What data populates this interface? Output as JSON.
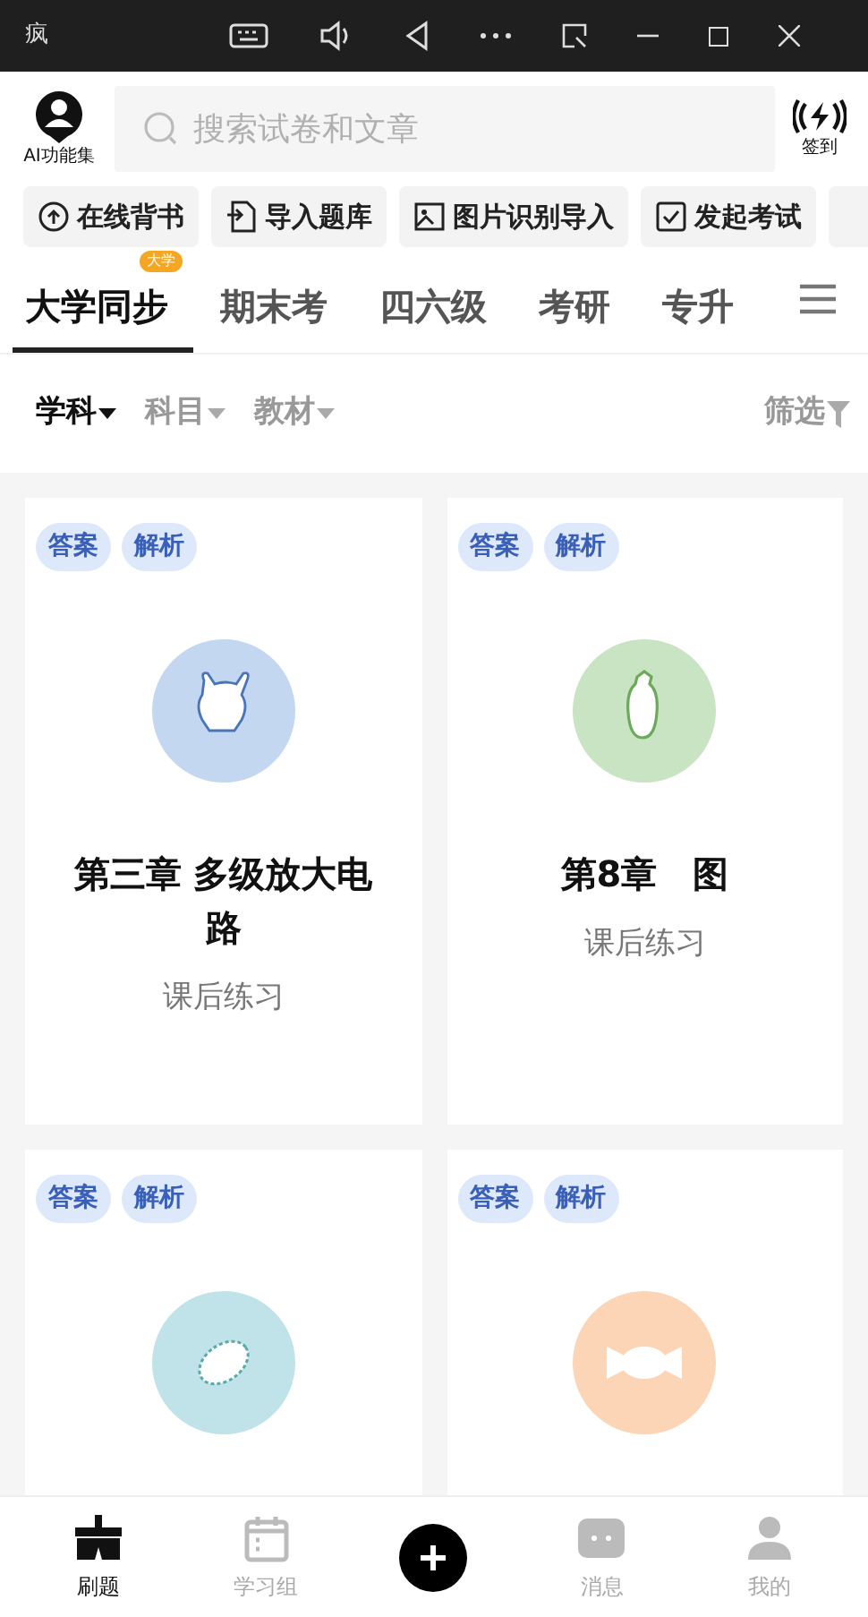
{
  "window": {
    "title": "疯"
  },
  "header": {
    "ai_label": "AI功能集",
    "search": {
      "placeholder": "搜索试卷和文章"
    },
    "checkin_label": "签到"
  },
  "quick_actions": [
    {
      "kind": "upload",
      "label": "在线背书"
    },
    {
      "kind": "import",
      "label": "导入题库"
    },
    {
      "kind": "image",
      "label": "图片识别导入"
    },
    {
      "kind": "exam",
      "label": "发起考试"
    }
  ],
  "tabs": [
    {
      "label": "大学同步",
      "badge": "大学",
      "selected": true
    },
    {
      "label": "期末考",
      "selected": false
    },
    {
      "label": "四六级",
      "selected": false
    },
    {
      "label": "考研",
      "selected": false
    },
    {
      "label": "专升",
      "selected": false
    }
  ],
  "filters": [
    {
      "label": "学科",
      "selected": true
    },
    {
      "label": "科目",
      "selected": false
    },
    {
      "label": "教材",
      "selected": false
    }
  ],
  "filter_button": "筛选",
  "cards": [
    {
      "tags": [
        "答案",
        "解析"
      ],
      "kind": "chicken",
      "color": "#c3d7f0",
      "title": "第三章 多级放大电路",
      "subtitle": "课后练习"
    },
    {
      "tags": [
        "答案",
        "解析"
      ],
      "kind": "eggplant",
      "color": "#c8e4c3",
      "title": "第8章　图",
      "subtitle": "课后练习"
    },
    {
      "tags": [
        "答案",
        "解析"
      ],
      "kind": "gourd",
      "color": "#bfe3e8"
    },
    {
      "tags": [
        "答案",
        "解析"
      ],
      "kind": "candy",
      "color": "#fbd5b5"
    }
  ],
  "bottom_nav": [
    {
      "kind": "brush",
      "label": "刷题",
      "selected": true
    },
    {
      "kind": "calendar",
      "label": "学习组",
      "selected": false
    },
    {
      "kind": "plus"
    },
    {
      "kind": "chat",
      "label": "消息",
      "selected": false
    },
    {
      "kind": "person",
      "label": "我的",
      "selected": false
    }
  ]
}
